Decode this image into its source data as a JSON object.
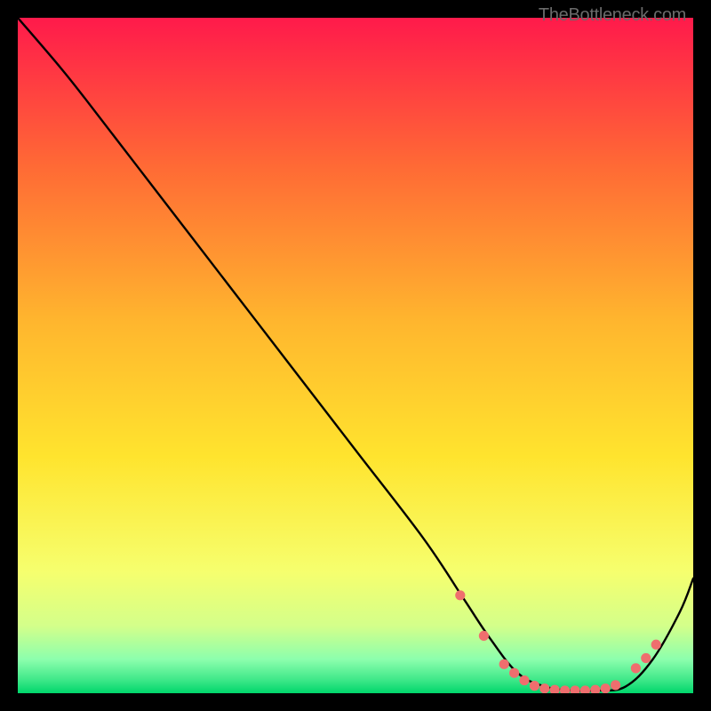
{
  "attribution": "TheBottleneck.com",
  "chart_data": {
    "type": "line",
    "title": "",
    "xlabel": "",
    "ylabel": "",
    "xlim": [
      0,
      100
    ],
    "ylim": [
      0,
      100
    ],
    "background": {
      "gradient": [
        "#ff1a4b",
        "#ff9a2e",
        "#ffe42e",
        "#fbff7a",
        "#93ffb5",
        "#00d66b"
      ]
    },
    "series": [
      {
        "name": "bottleneck-curve",
        "x": [
          0,
          6,
          10,
          20,
          30,
          40,
          50,
          60,
          66,
          70,
          74,
          78,
          82,
          86,
          90,
          94,
          98,
          100
        ],
        "y": [
          100,
          93,
          88,
          75,
          62,
          49,
          36,
          23,
          14,
          8,
          3,
          1,
          0.4,
          0.4,
          1,
          5,
          12,
          17
        ],
        "color": "#000000"
      }
    ],
    "markers": {
      "name": "highlight-dots",
      "x": [
        65.5,
        69,
        72,
        73.5,
        75,
        76.5,
        78,
        79.5,
        81,
        82.5,
        84,
        85.5,
        87,
        88.5,
        91.5,
        93,
        94.5
      ],
      "y": [
        14.5,
        8.5,
        4.3,
        3.0,
        1.9,
        1.1,
        0.7,
        0.5,
        0.4,
        0.4,
        0.4,
        0.5,
        0.7,
        1.2,
        3.7,
        5.2,
        7.2
      ],
      "color": "#ef6e6e",
      "r": 5.6
    }
  }
}
